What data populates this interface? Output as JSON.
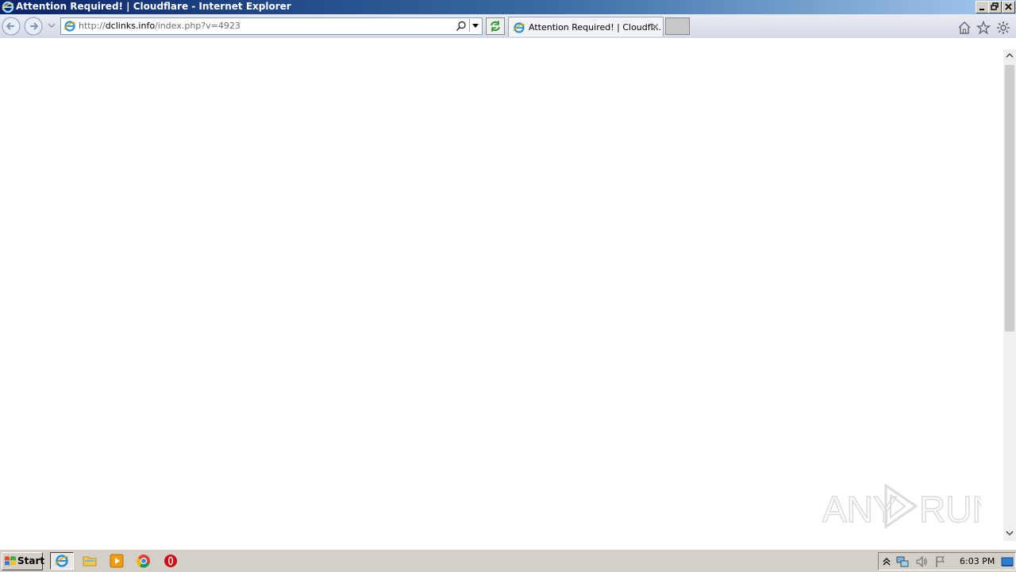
{
  "window": {
    "title": "Attention Required! | Cloudflare - Internet Explorer"
  },
  "address_bar": {
    "url_prefix": "http://",
    "url_host": "dclinks.info",
    "url_path": "/index.php?v=4923"
  },
  "tabs": [
    {
      "label": "Attention Required! | Cloudfl...",
      "close": "×"
    }
  ],
  "taskbar": {
    "start_label": "Start",
    "clock": "6:03 PM",
    "pinned": [
      "internet-explorer",
      "file-explorer",
      "media-player",
      "chrome",
      "opera"
    ]
  },
  "watermark": {
    "text": "ANY RUN"
  },
  "colors": {
    "titlebar_start": "#0a246a",
    "titlebar_end": "#a6caf0",
    "taskbar": "#d4d0c8"
  }
}
